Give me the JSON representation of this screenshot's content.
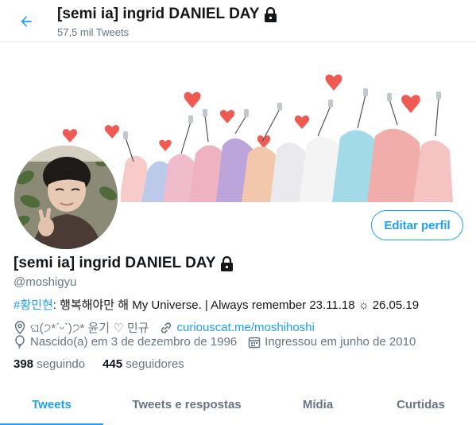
{
  "header": {
    "title": "[semi ia] ingrid DANIEL DAY",
    "subtitle": "57,5 mil Tweets"
  },
  "profile": {
    "name": "[semi ia] ingrid DANIEL DAY",
    "handle": "@moshigyu",
    "edit_label": "Editar perfil",
    "bio": {
      "hashtag": "#황민현",
      "text": ": 행복해야만 해 My Universe. | Always remember 23.11.18 ☼ 26.05.19"
    },
    "location": "ଘ(੭*ˊᵕˋ)੭* 윤기 ♡ 민규",
    "website": "curiouscat.me/moshihoshi",
    "birthday": "Nascido(a) em 3 de dezembro de 1996",
    "joined": "Ingressou em junho de 2010",
    "following": {
      "count": "398",
      "label": "seguindo"
    },
    "followers": {
      "count": "445",
      "label": "seguidores"
    }
  },
  "tabs": [
    {
      "label": "Tweets"
    },
    {
      "label": "Tweets e respostas"
    },
    {
      "label": "Mídia"
    },
    {
      "label": "Curtidas"
    }
  ],
  "colors": {
    "accent": "#1da1f2",
    "text": "#14171a",
    "muted": "#657786"
  },
  "icons": {
    "back": "arrow-left-icon",
    "lock": "lock-icon",
    "location": "location-icon",
    "link": "link-icon",
    "birthday": "balloon-icon",
    "calendar": "calendar-icon"
  }
}
